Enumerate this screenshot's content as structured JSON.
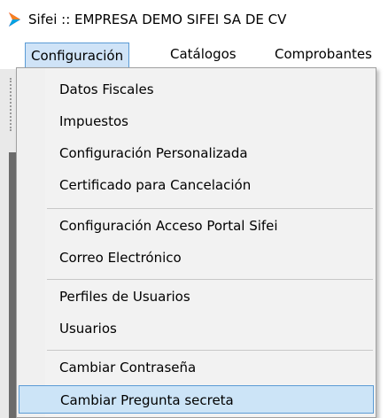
{
  "window": {
    "title": "Sifei :: EMPRESA DEMO SIFEI SA DE CV",
    "logo_icon": "sifei-logo-icon"
  },
  "menubar": {
    "items": [
      {
        "label": "Configuración"
      },
      {
        "label": "Catálogos"
      },
      {
        "label": "Comprobantes"
      }
    ]
  },
  "dropdown": {
    "items": [
      {
        "label": "Datos Fiscales"
      },
      {
        "label": "Impuestos"
      },
      {
        "label": "Configuración Personalizada"
      },
      {
        "label": "Certificado para Cancelación"
      },
      {
        "label": "Configuración Acceso Portal Sifei"
      },
      {
        "label": "Correo Electrónico"
      },
      {
        "label": "Perfiles de Usuarios"
      },
      {
        "label": "Usuarios"
      },
      {
        "label": "Cambiar Contraseña"
      },
      {
        "label": "Cambiar Pregunta secreta"
      }
    ]
  },
  "colors": {
    "highlight": "#cce4f7",
    "highlight_border": "#5b9bd5",
    "logo_orange": "#f58220",
    "logo_pink": "#e6007e",
    "logo_blue": "#00a3e0"
  }
}
